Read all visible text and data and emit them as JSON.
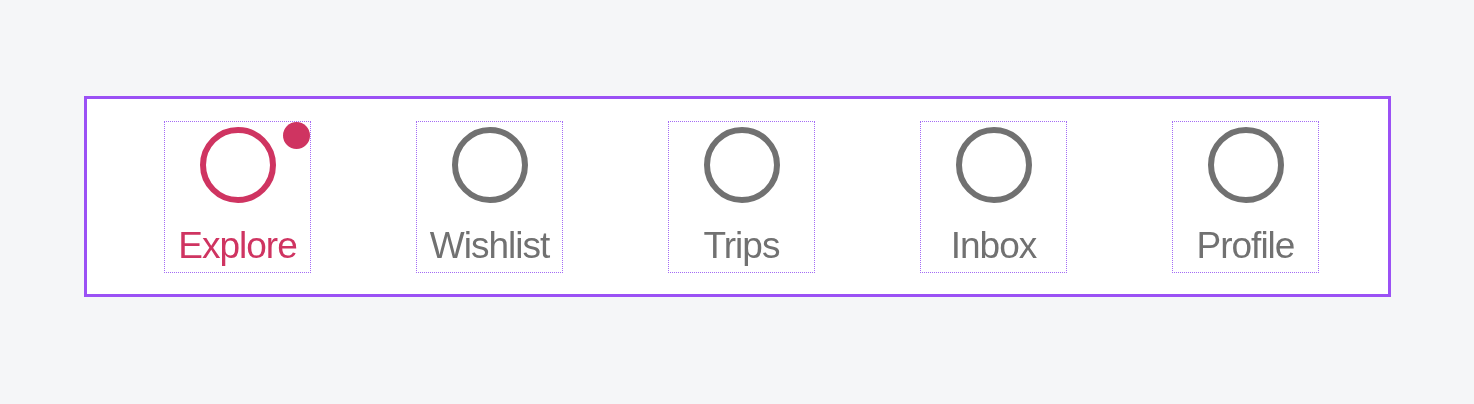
{
  "tab_bar": {
    "tabs": [
      {
        "label": "Explore",
        "selected": true,
        "badge": true
      },
      {
        "label": "Wishlist",
        "selected": false,
        "badge": false
      },
      {
        "label": "Trips",
        "selected": false,
        "badge": false
      },
      {
        "label": "Inbox",
        "selected": false,
        "badge": false
      },
      {
        "label": "Profile",
        "selected": false,
        "badge": false
      }
    ]
  }
}
